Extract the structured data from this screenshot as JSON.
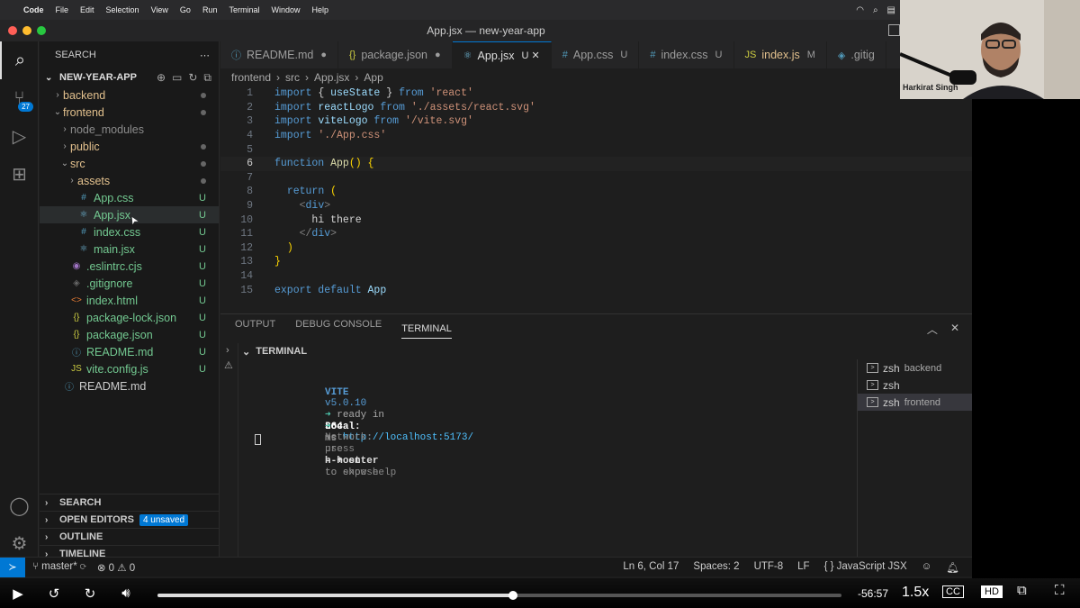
{
  "menubar": {
    "app": "Code",
    "items": [
      "File",
      "Edit",
      "Selection",
      "View",
      "Go",
      "Run",
      "Terminal",
      "Window",
      "Help"
    ]
  },
  "window": {
    "title": "App.jsx — new-year-app"
  },
  "sidebar": {
    "header": "SEARCH",
    "project": "NEW-YEAR-APP",
    "items": [
      {
        "label": "backend",
        "type": "folder",
        "open": false,
        "indent": 1,
        "status": "dot"
      },
      {
        "label": "frontend",
        "type": "folder",
        "open": true,
        "indent": 1,
        "status": "dot"
      },
      {
        "label": "node_modules",
        "type": "folder",
        "open": false,
        "indent": 2,
        "status": ""
      },
      {
        "label": "public",
        "type": "folder",
        "open": false,
        "indent": 2,
        "status": "dot"
      },
      {
        "label": "src",
        "type": "folder",
        "open": true,
        "indent": 2,
        "status": "dot"
      },
      {
        "label": "assets",
        "type": "folder",
        "open": false,
        "indent": 3,
        "status": "dot"
      },
      {
        "label": "App.css",
        "type": "css",
        "indent": 3,
        "status": "U"
      },
      {
        "label": "App.jsx",
        "type": "jsx",
        "indent": 3,
        "status": "U"
      },
      {
        "label": "index.css",
        "type": "css",
        "indent": 3,
        "status": "U"
      },
      {
        "label": "main.jsx",
        "type": "jsx",
        "indent": 3,
        "status": "U"
      },
      {
        "label": ".eslintrc.cjs",
        "type": "eslint",
        "indent": 2,
        "status": "U"
      },
      {
        "label": ".gitignore",
        "type": "git",
        "indent": 2,
        "status": "U"
      },
      {
        "label": "index.html",
        "type": "html",
        "indent": 2,
        "status": "U"
      },
      {
        "label": "package-lock.json",
        "type": "json",
        "indent": 2,
        "status": "U"
      },
      {
        "label": "package.json",
        "type": "json",
        "indent": 2,
        "status": "U"
      },
      {
        "label": "README.md",
        "type": "md",
        "indent": 2,
        "status": "U"
      },
      {
        "label": "vite.config.js",
        "type": "js",
        "indent": 2,
        "status": "U"
      },
      {
        "label": "README.md",
        "type": "md",
        "indent": 1,
        "status": ""
      }
    ],
    "sections": [
      {
        "label": "SEARCH"
      },
      {
        "label": "OPEN EDITORS",
        "badge": "4 unsaved"
      },
      {
        "label": "OUTLINE"
      },
      {
        "label": "TIMELINE"
      }
    ],
    "activity_badge": "27"
  },
  "tabs": [
    {
      "icon": "ⓘ",
      "label": "README.md",
      "mark": "●",
      "active": false
    },
    {
      "icon": "{}",
      "label": "package.json",
      "mark": "●",
      "active": false
    },
    {
      "icon": "⚛",
      "label": "App.jsx",
      "mark": "U  ✕",
      "active": true
    },
    {
      "icon": "#",
      "label": "App.css",
      "mark": "U",
      "active": false
    },
    {
      "icon": "#",
      "label": "index.css",
      "mark": "U",
      "active": false
    },
    {
      "icon": "JS",
      "label": "index.js",
      "mark": "M",
      "active": false
    },
    {
      "icon": "◈",
      "label": ".gitig",
      "mark": "",
      "active": false
    }
  ],
  "breadcrumb": [
    "frontend",
    "src",
    "App.jsx",
    "App"
  ],
  "code": {
    "current_line": 6,
    "lines": [
      [
        [
          "k",
          "import "
        ],
        [
          "p",
          "{ "
        ],
        [
          "v",
          "useState"
        ],
        [
          "p",
          " } "
        ],
        [
          "k",
          "from "
        ],
        [
          "s",
          "'react'"
        ]
      ],
      [
        [
          "k",
          "import "
        ],
        [
          "v",
          "reactLogo"
        ],
        [
          "k",
          " from "
        ],
        [
          "s",
          "'./assets/react.svg'"
        ]
      ],
      [
        [
          "k",
          "import "
        ],
        [
          "v",
          "viteLogo"
        ],
        [
          "k",
          " from "
        ],
        [
          "s",
          "'/vite.svg'"
        ]
      ],
      [
        [
          "k",
          "import "
        ],
        [
          "s",
          "'./App.css'"
        ]
      ],
      [],
      [
        [
          "k",
          "function "
        ],
        [
          "fn",
          "App"
        ],
        [
          "br",
          "() {"
        ]
      ],
      [],
      [
        [
          "p",
          "  "
        ],
        [
          "k",
          "return "
        ],
        [
          "br",
          "("
        ]
      ],
      [
        [
          "p",
          "    "
        ],
        [
          "t",
          "<"
        ],
        [
          "tg",
          "div"
        ],
        [
          "t",
          ">"
        ]
      ],
      [
        [
          "p",
          "      hi there"
        ]
      ],
      [
        [
          "p",
          "    "
        ],
        [
          "t",
          "</"
        ],
        [
          "tg",
          "div"
        ],
        [
          "t",
          ">"
        ]
      ],
      [
        [
          "p",
          "  "
        ],
        [
          "br",
          ")"
        ]
      ],
      [
        [
          "br",
          "}"
        ]
      ],
      [],
      [
        [
          "k",
          "export default "
        ],
        [
          "v",
          "App"
        ]
      ]
    ]
  },
  "panel": {
    "tabs": [
      {
        "label": "OUTPUT"
      },
      {
        "label": "DEBUG CONSOLE"
      },
      {
        "label": "TERMINAL",
        "active": true
      }
    ],
    "terminal_title": "TERMINAL",
    "output": {
      "vite": "VITE",
      "version": "v5.0.10",
      "ready": "ready in",
      "ms_value": "364",
      "ms": "ms",
      "local_label": "Local:",
      "local_url": "http://localhost:5173/",
      "network_label": "Network:",
      "network_text": "use",
      "host_flag": "--host",
      "expose": "to expose",
      "press": "press",
      "keys": "h + enter",
      "help": "to show help",
      "arrow": "➜"
    },
    "terminals": [
      {
        "label": "zsh",
        "sub": "backend"
      },
      {
        "label": "zsh",
        "sub": ""
      },
      {
        "label": "zsh",
        "sub": "frontend",
        "selected": true
      }
    ]
  },
  "status": {
    "branch": "master*",
    "problems": "⊗ 0 ⚠ 0",
    "position": "Ln 6, Col 17",
    "spaces": "Spaces: 2",
    "encoding": "UTF-8",
    "eol": "LF",
    "language": "JavaScript JSX"
  },
  "video": {
    "presenter": "Harkirat Singh",
    "time_remaining": "-56:57",
    "speed": "1.5x",
    "progress": 0.52,
    "cc": "CC",
    "hd": "HD"
  },
  "colors": {
    "accent": "#0078d4",
    "tl_red": "#ff5f57",
    "tl_yellow": "#febc2e",
    "tl_green": "#28c840"
  }
}
